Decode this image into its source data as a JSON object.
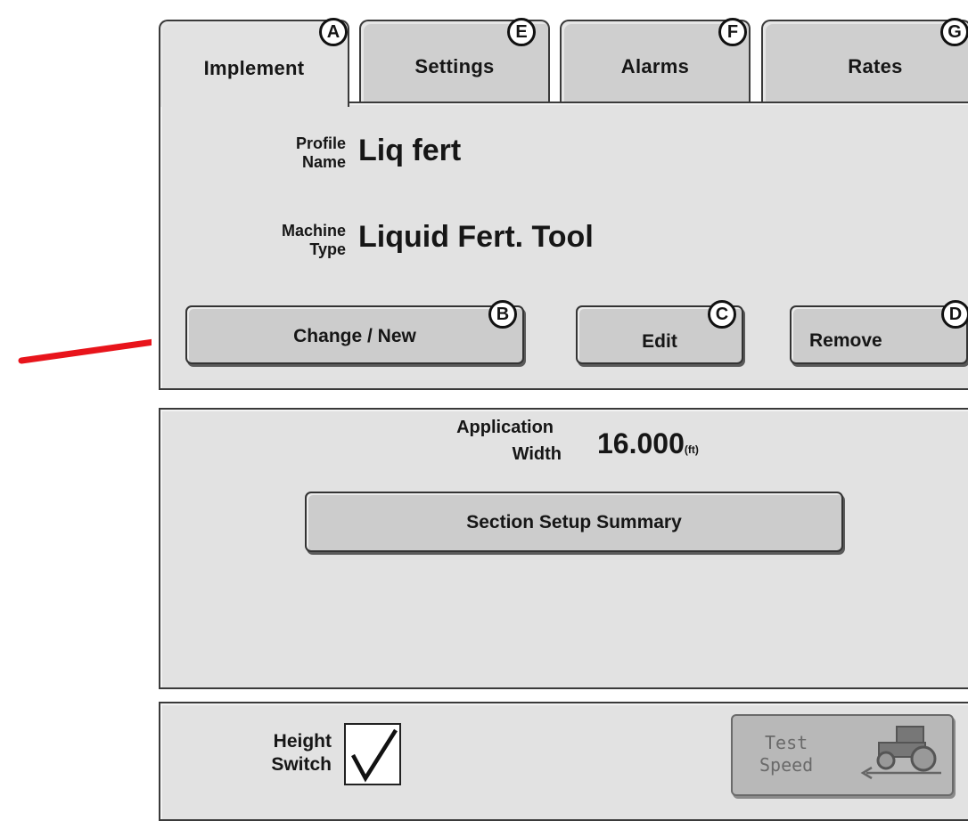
{
  "tabs": [
    {
      "label": "Implement",
      "callout": "A"
    },
    {
      "label": "Settings",
      "callout": "E"
    },
    {
      "label": "Alarms",
      "callout": "F"
    },
    {
      "label": "Rates",
      "callout": "G"
    }
  ],
  "profile": {
    "name_label_line1": "Profile",
    "name_label_line2": "Name",
    "name_value": "Liq fert",
    "machine_label_line1": "Machine",
    "machine_label_line2": "Type",
    "machine_value": "Liquid Fert. Tool"
  },
  "buttons": {
    "change_new": {
      "label": "Change / New",
      "callout": "B"
    },
    "edit": {
      "label": "Edit",
      "callout": "C"
    },
    "remove": {
      "label": "Remove",
      "callout": "D"
    },
    "section_setup": {
      "label": "Section Setup Summary"
    }
  },
  "application": {
    "label_line1": "Application",
    "label_line2": "Width",
    "value": "16.000",
    "unit": "(ft)"
  },
  "footer": {
    "height_switch_line1": "Height",
    "height_switch_line2": "Switch",
    "height_switch_checked": true,
    "test_speed_line1": "Test",
    "test_speed_line2": "Speed"
  },
  "colors": {
    "arrow": "#e8141b",
    "panel": "#e2e2e2",
    "tab": "#cfcfcf",
    "button": "#cccccc",
    "disabled_text": "#6a6a6a"
  },
  "icons": {
    "checkbox": "checkmark-icon",
    "test_speed": "tractor-icon",
    "pointer": "red-arrow"
  }
}
